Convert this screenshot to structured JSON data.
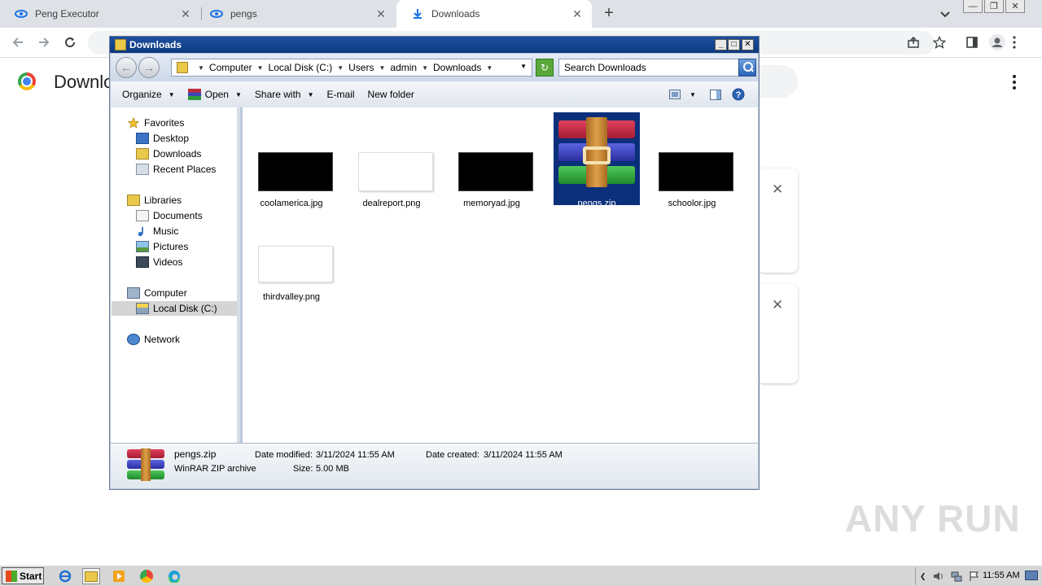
{
  "browser": {
    "tabs": [
      {
        "label": "Peng Executor",
        "active": false
      },
      {
        "label": "pengs",
        "active": false
      },
      {
        "label": "Downloads",
        "active": true
      }
    ],
    "page_title": "Downlo",
    "tab_close_glyph": "✕",
    "new_tab_glyph": "+"
  },
  "explorer": {
    "title": "Downloads",
    "breadcrumb": [
      "Computer",
      "Local Disk (C:)",
      "Users",
      "admin",
      "Downloads"
    ],
    "search_placeholder": "Search Downloads",
    "commands": {
      "organize": "Organize",
      "open": "Open",
      "share_with": "Share with",
      "email": "E-mail",
      "new_folder": "New folder"
    },
    "nav": {
      "favorites": "Favorites",
      "desktop": "Desktop",
      "downloads": "Downloads",
      "recent_places": "Recent Places",
      "libraries": "Libraries",
      "documents": "Documents",
      "music": "Music",
      "pictures": "Pictures",
      "videos": "Videos",
      "computer": "Computer",
      "local_disk": "Local Disk (C:)",
      "network": "Network"
    },
    "files": [
      {
        "name": "coolamerica.jpg",
        "thumb": "dark"
      },
      {
        "name": "dealreport.png",
        "thumb": "light"
      },
      {
        "name": "memoryad.jpg",
        "thumb": "dark"
      },
      {
        "name": "pengs.zip",
        "thumb": "winrar",
        "selected": true
      },
      {
        "name": "schoolor.jpg",
        "thumb": "dark"
      },
      {
        "name": "thirdvalley.png",
        "thumb": "light"
      }
    ],
    "details": {
      "name": "pengs.zip",
      "type": "WinRAR ZIP archive",
      "date_modified_label": "Date modified:",
      "date_modified": "3/11/2024 11:55 AM",
      "date_created_label": "Date created:",
      "date_created": "3/11/2024 11:55 AM",
      "size_label": "Size:",
      "size": "5.00 MB"
    }
  },
  "taskbar": {
    "start_label": "Start",
    "clock": "11:55 AM"
  },
  "watermark": "ANY RUN",
  "colors": {
    "title_bar": "#1c4f9e",
    "selection": "#0b2f7a",
    "tabstrip": "#dee1e6"
  }
}
